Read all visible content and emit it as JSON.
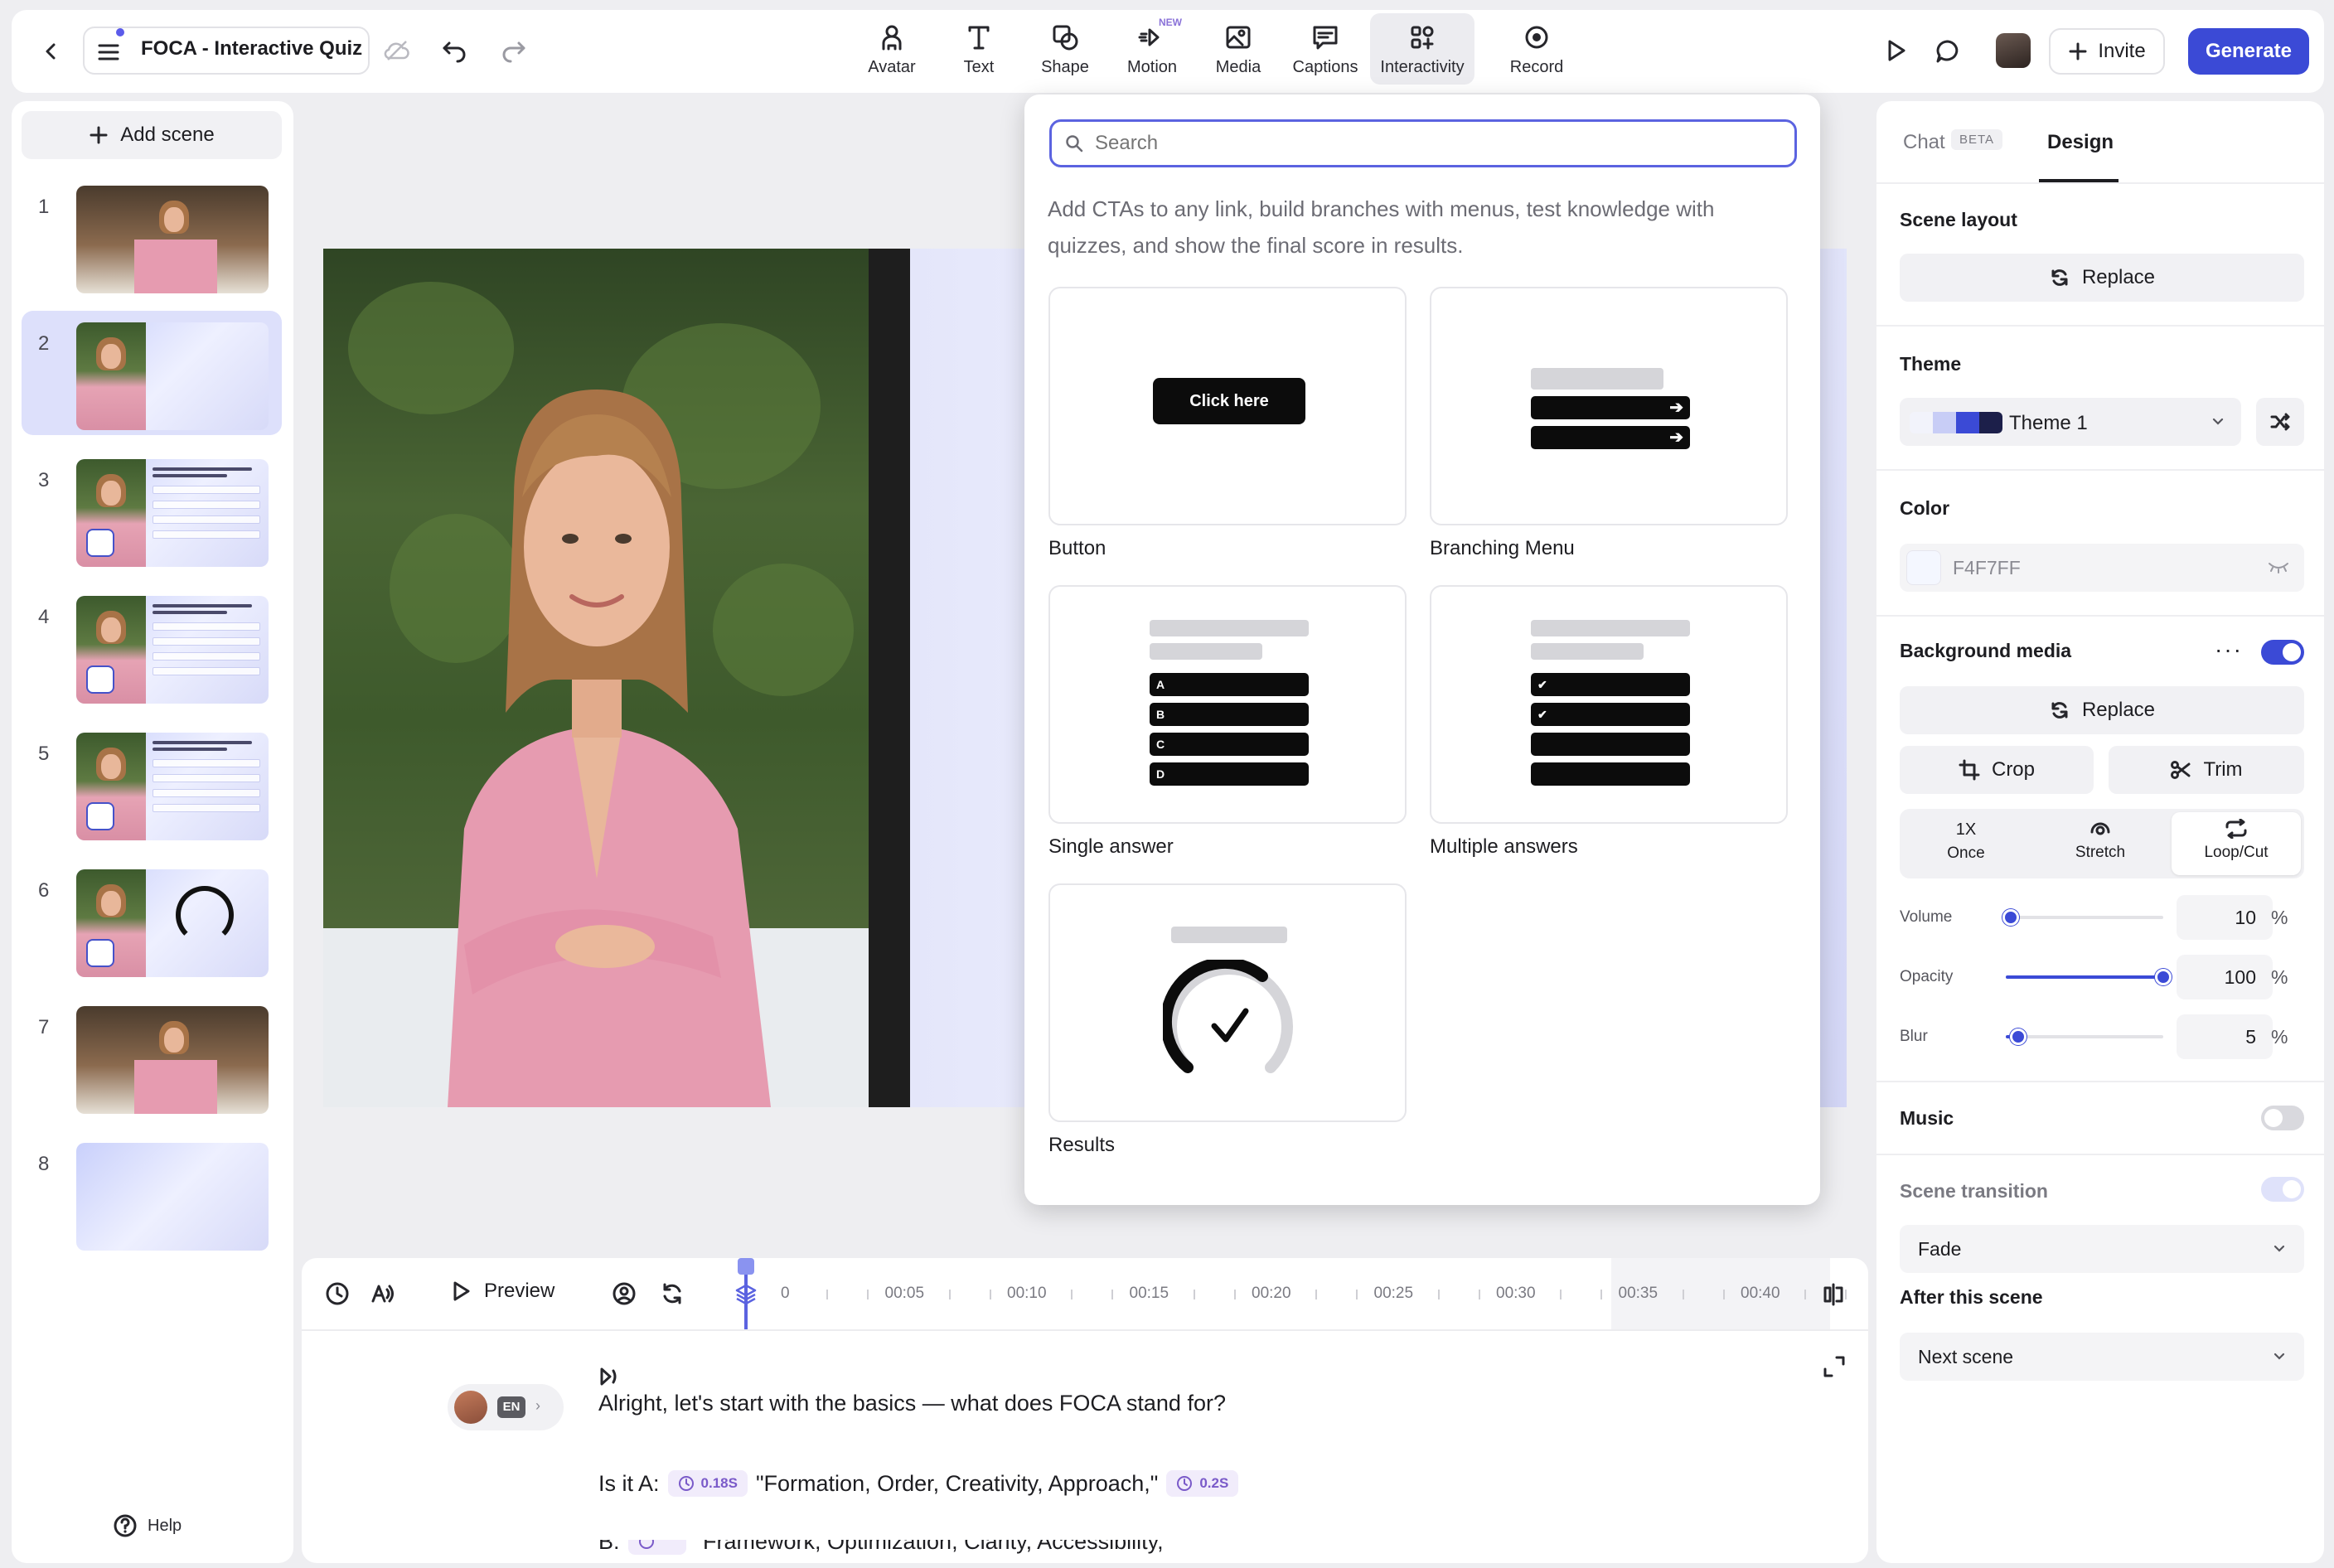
{
  "topbar": {
    "project_title": "FOCA - Interactive Quiz",
    "tools": [
      {
        "label": "Avatar",
        "icon": "avatar-icon"
      },
      {
        "label": "Text",
        "icon": "text-icon"
      },
      {
        "label": "Shape",
        "icon": "shape-icon"
      },
      {
        "label": "Motion",
        "icon": "motion-icon"
      },
      {
        "label": "Media",
        "icon": "media-icon"
      },
      {
        "label": "Captions",
        "icon": "captions-icon"
      },
      {
        "label": "Interactivity",
        "icon": "interactivity-icon"
      },
      {
        "label": "Record",
        "icon": "record-icon"
      }
    ],
    "new_badge": "NEW",
    "invite_label": "Invite",
    "generate_label": "Generate"
  },
  "scenes": {
    "add_label": "Add scene",
    "items": [
      {
        "number": "1",
        "kind": "avatar-kitchen"
      },
      {
        "number": "2",
        "kind": "avatar-gradient"
      },
      {
        "number": "3",
        "kind": "quiz"
      },
      {
        "number": "4",
        "kind": "quiz"
      },
      {
        "number": "5",
        "kind": "quiz"
      },
      {
        "number": "6",
        "kind": "results"
      },
      {
        "number": "7",
        "kind": "avatar-kitchen"
      },
      {
        "number": "8",
        "kind": "gradient"
      }
    ],
    "active_index": 1,
    "help_label": "Help"
  },
  "popup": {
    "search_placeholder": "Search",
    "description": "Add CTAs to any link, build branches with menus, test knowledge with quizzes, and show the final score in results.",
    "cards": {
      "button": {
        "label": "Button",
        "preview_text": "Click here"
      },
      "branching": {
        "label": "Branching Menu"
      },
      "single": {
        "label": "Single answer",
        "options": [
          "A",
          "B",
          "C",
          "D"
        ]
      },
      "multiple": {
        "label": "Multiple answers"
      },
      "results": {
        "label": "Results"
      }
    }
  },
  "timeline": {
    "preview_label": "Preview",
    "ticks": [
      "0",
      "00:05",
      "00:10",
      "00:15",
      "00:20",
      "00:25",
      "00:30",
      "00:35",
      "00:40"
    ]
  },
  "script": {
    "language": "EN",
    "line1": "Alright, let's start with the basics — what does FOCA stand for?",
    "line2_prefix": "Is it A:",
    "pause1": "0.18S",
    "line2_quote": "\"Formation, Order, Creativity, Approach,\"",
    "pause2": "0.2S",
    "line3_prefix": "B:",
    "line3_quote": "\"Framework, Optimization, Clarity, Accessibility,\""
  },
  "design": {
    "tab_chat": "Chat",
    "tab_beta": "BETA",
    "tab_design": "Design",
    "scene_layout_title": "Scene layout",
    "replace_label": "Replace",
    "theme_title": "Theme",
    "theme_name": "Theme 1",
    "theme_swatches": [
      "#f2f3fb",
      "#c8cdf6",
      "#3b4ad6",
      "#1c1f4a"
    ],
    "color_title": "Color",
    "color_value": "F4F7FF",
    "bg_media_title": "Background media",
    "bg_media_on": true,
    "crop_label": "Crop",
    "trim_label": "Trim",
    "loop_options": [
      {
        "top": "1X",
        "label": "Once"
      },
      {
        "top": "",
        "label": "Stretch"
      },
      {
        "top": "",
        "label": "Loop/Cut"
      }
    ],
    "loop_selected": "Loop/Cut",
    "sliders": [
      {
        "label": "Volume",
        "value": "10",
        "fraction": 0.03
      },
      {
        "label": "Opacity",
        "value": "100",
        "fraction": 1.0
      },
      {
        "label": "Blur",
        "value": "5",
        "fraction": 0.08
      }
    ],
    "percent_sign": "%",
    "music_title": "Music",
    "music_on": false,
    "transition_title": "Scene transition",
    "transition_value": "Fade",
    "after_title": "After this scene",
    "after_value": "Next scene"
  },
  "colors": {
    "accent": "#3b4ad6",
    "selected_scene": "#dde0fb"
  }
}
